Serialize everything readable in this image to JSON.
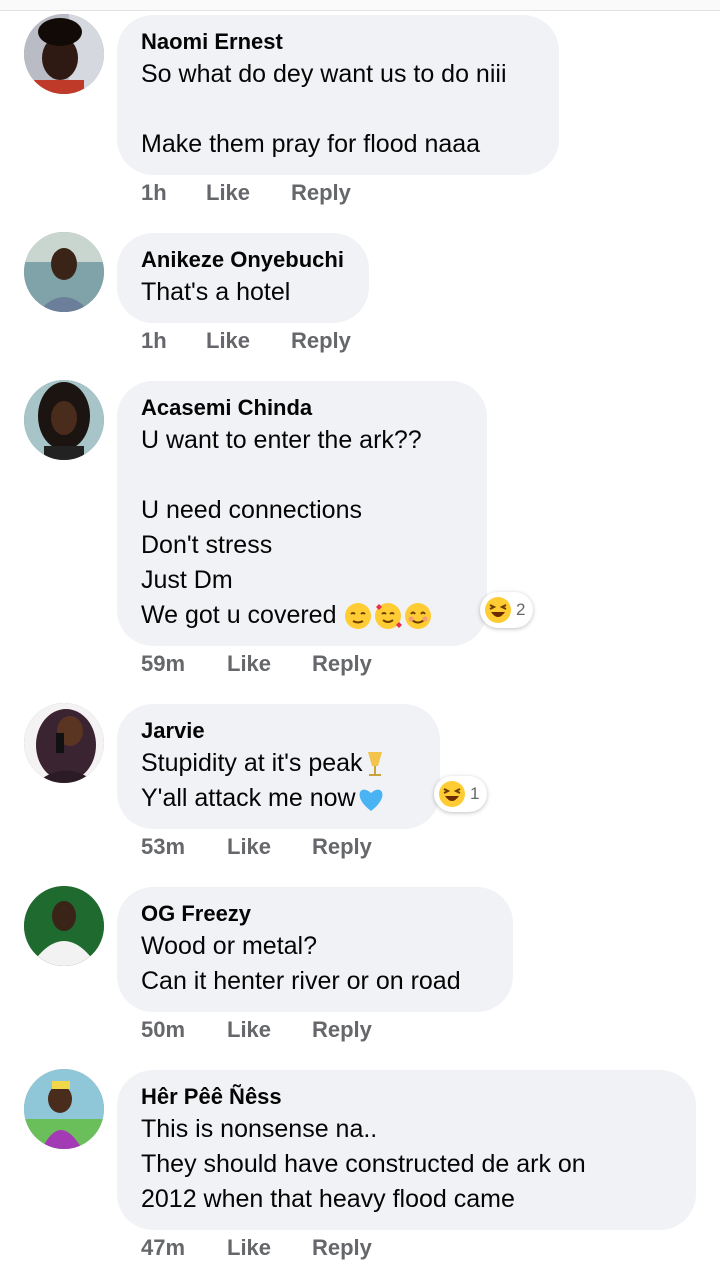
{
  "actions": {
    "like": "Like",
    "reply": "Reply"
  },
  "comments": [
    {
      "author": "Naomi Ernest",
      "lines": [
        "So what do dey want us to do niii",
        "",
        "Make them pray for flood naaa"
      ],
      "time": "1h"
    },
    {
      "author": "Anikeze Onyebuchi",
      "lines": [
        "That's a hotel"
      ],
      "time": "1h"
    },
    {
      "author": "Acasemi Chinda",
      "lines": [
        "U want to enter the ark??",
        "",
        "U need connections",
        "Don't stress",
        "Just Dm",
        "We got u covered "
      ],
      "time": "59m",
      "reaction_icon": "laughing-emoji",
      "reaction_count": "2"
    },
    {
      "author": "Jarvie",
      "lines": [
        "Stupidity at it's peak",
        "Y'all attack me now"
      ],
      "time": "53m",
      "reaction_icon": "laughing-emoji",
      "reaction_count": "1"
    },
    {
      "author": "OG Freezy",
      "lines": [
        "Wood or metal?",
        "Can it henter river or on road"
      ],
      "time": "50m"
    },
    {
      "author": "Hêr Pêê Ñêss",
      "lines": [
        "This is nonsense na..",
        "They should have constructed de ark on",
        "2012 when that heavy flood came"
      ],
      "time": "47m"
    }
  ],
  "colors": {
    "bubble": "#f0f2f5",
    "meta": "#65676b",
    "text": "#050505"
  }
}
